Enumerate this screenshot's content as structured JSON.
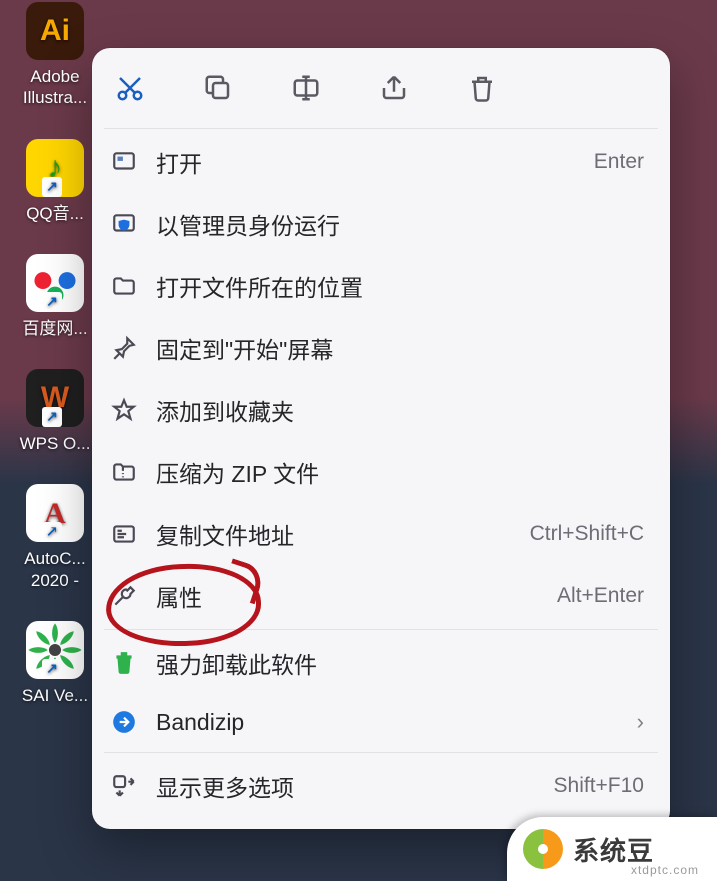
{
  "desktop": {
    "icons": [
      {
        "label": "Adobe Illustra...",
        "glyph": "Ai",
        "cls": "ai-bg",
        "shortcut": false
      },
      {
        "label": "QQ音...",
        "glyph": "♪",
        "cls": "qq-bg",
        "shortcut": true
      },
      {
        "label": "百度网...",
        "glyph": "⊚",
        "cls": "baidu-bg",
        "shortcut": true
      },
      {
        "label": "WPS O...",
        "glyph": "W",
        "cls": "wps-bg",
        "shortcut": true
      },
      {
        "label": "AutoC... 2020 -",
        "glyph": "A",
        "cls": "autocad-bg",
        "shortcut": true
      },
      {
        "label": "SAI Ve...",
        "glyph": "✺",
        "cls": "sai-bg",
        "shortcut": true
      }
    ]
  },
  "toolbar": {
    "items": [
      {
        "name": "cut-icon",
        "accent": true
      },
      {
        "name": "copy-icon",
        "accent": false
      },
      {
        "name": "rename-icon",
        "accent": false
      },
      {
        "name": "share-icon",
        "accent": false
      },
      {
        "name": "delete-icon",
        "accent": false
      }
    ]
  },
  "menu": {
    "items": [
      {
        "icon": "open-icon",
        "label": "打开",
        "shortcut": "Enter"
      },
      {
        "icon": "shield-icon",
        "label": "以管理员身份运行",
        "shortcut": ""
      },
      {
        "icon": "folder-icon",
        "label": "打开文件所在的位置",
        "shortcut": ""
      },
      {
        "icon": "pin-icon",
        "label": "固定到\"开始\"屏幕",
        "shortcut": ""
      },
      {
        "icon": "star-icon",
        "label": "添加到收藏夹",
        "shortcut": ""
      },
      {
        "icon": "zip-icon",
        "label": "压缩为 ZIP 文件",
        "shortcut": ""
      },
      {
        "icon": "copy-path-icon",
        "label": "复制文件地址",
        "shortcut": "Ctrl+Shift+C"
      },
      {
        "icon": "wrench-icon",
        "label": "属性",
        "shortcut": "Alt+Enter"
      },
      {
        "sep": true
      },
      {
        "icon": "uninstall-icon",
        "label": "强力卸载此软件",
        "shortcut": "",
        "iconCls": "green"
      },
      {
        "icon": "bandizip-icon",
        "label": "Bandizip",
        "shortcut": "",
        "submenu": true,
        "iconCls": "blue"
      },
      {
        "sep": true
      },
      {
        "icon": "more-icon",
        "label": "显示更多选项",
        "shortcut": "Shift+F10"
      }
    ]
  },
  "watermark": {
    "text": "系统豆",
    "sub": "xtdptc.com"
  }
}
